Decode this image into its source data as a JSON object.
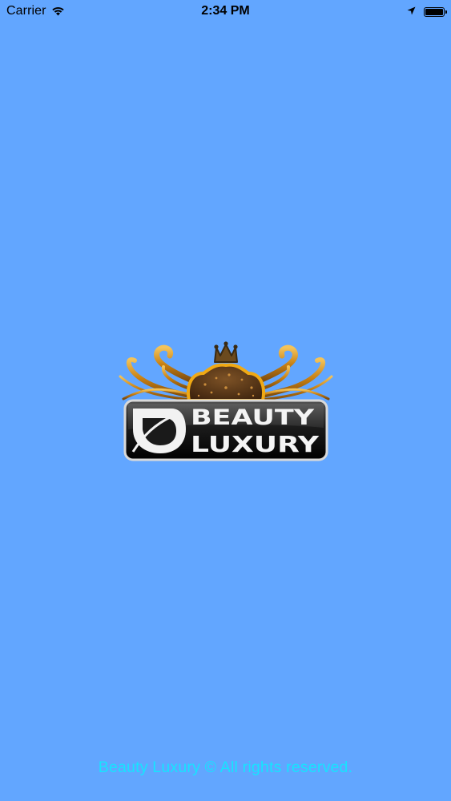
{
  "status_bar": {
    "carrier": "Carrier",
    "time": "2:34 PM",
    "battery_level": 1.0,
    "icons": [
      "wifi-icon",
      "location-arrow-icon",
      "battery-icon"
    ]
  },
  "logo": {
    "line1": "BEAUTY",
    "line2": "LUXURY",
    "icons": [
      "crown-icon",
      "leaf-icon"
    ]
  },
  "footer": {
    "text": "Beauty Luxury © All rights reserved."
  },
  "colors": {
    "background": "#62a6ff",
    "footer_text": "#16e4ff",
    "logo_gold": "#e0a21c",
    "logo_plate": "#1e1e1e"
  }
}
